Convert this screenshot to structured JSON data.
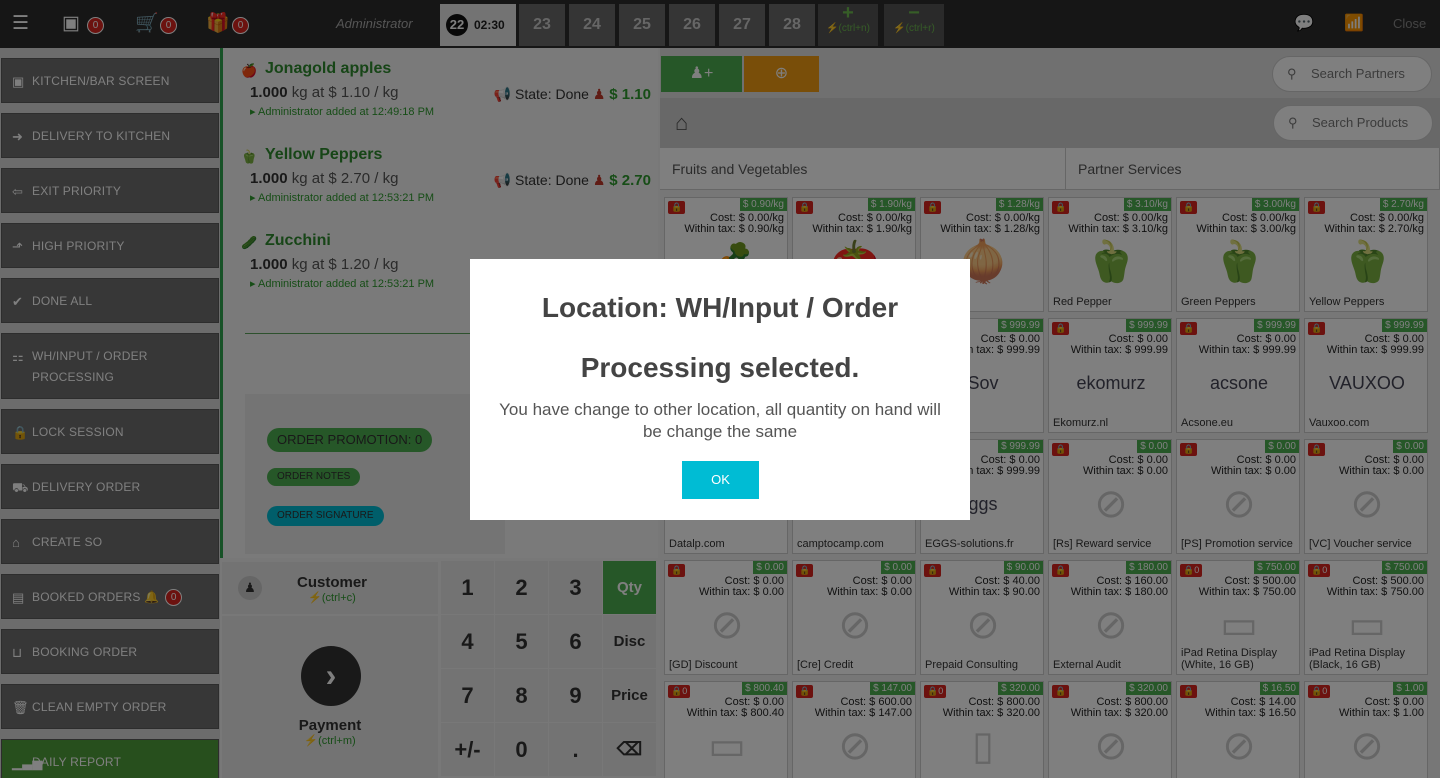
{
  "topbar": {
    "badges": [
      "0",
      "0",
      "0"
    ],
    "user": "Administrator",
    "active_tab": {
      "number": "22",
      "time": "02:30"
    },
    "tabs": [
      "23",
      "24",
      "25",
      "26",
      "27",
      "28"
    ],
    "add_order": {
      "symbol": "+",
      "shortcut": "(ctrl+n)"
    },
    "remove_order": {
      "symbol": "−",
      "shortcut": "(ctrl+r)"
    },
    "close": "Close"
  },
  "left_menu": {
    "items": [
      {
        "label": "KITCHEN/BAR SCREEN",
        "icon": "monitor-icon",
        "glyph": "▣"
      },
      {
        "label": "DELIVERY TO KITCHEN",
        "icon": "arrow-circle-right-icon",
        "glyph": "➜"
      },
      {
        "label": "EXIT PRIORITY",
        "icon": "arrow-circle-left-icon",
        "glyph": "⇦"
      },
      {
        "label": "HIGH PRIORITY",
        "icon": "level-up-icon",
        "glyph": "⬏"
      },
      {
        "label": "DONE ALL",
        "icon": "check-circle-icon",
        "glyph": "✔"
      },
      {
        "label": "WH/INPUT / ORDER",
        "label2": "PROCESSING",
        "icon": "sitemap-icon",
        "glyph": "⚏"
      },
      {
        "label": "LOCK SESSION",
        "icon": "lock-icon",
        "glyph": "🔒"
      },
      {
        "label": "DELIVERY ORDER",
        "icon": "truck-icon",
        "glyph": "⛟"
      },
      {
        "label": "CREATE SO",
        "icon": "shopping-bag-icon",
        "glyph": "⌂"
      },
      {
        "label": "BOOKED ORDERS",
        "icon": "book-icon",
        "glyph": "▤",
        "badge": "0"
      },
      {
        "label": "BOOKING ORDER",
        "icon": "basket-icon",
        "glyph": "⊔"
      },
      {
        "label": "CLEAN EMPTY ORDER",
        "icon": "trash-icon",
        "glyph": "🗑"
      },
      {
        "label": "DAILY REPORT",
        "icon": "signal-icon",
        "glyph": "▁▃▅"
      }
    ]
  },
  "order": {
    "lines": [
      {
        "name": "Jonagold apples",
        "qty": "1.000",
        "detail": "kg at $ 1.10 / kg",
        "state": "State: Done",
        "price": "$ 1.10",
        "added": "Administrator added at 12:49:18 PM",
        "emoji": "🍎"
      },
      {
        "name": "Yellow Peppers",
        "qty": "1.000",
        "detail": "kg at $ 2.70 / kg",
        "state": "State: Done",
        "price": "$ 2.70",
        "added": "Administrator added at 12:53:21 PM",
        "emoji": "🫑"
      },
      {
        "name": "Zucchini",
        "qty": "1.000",
        "detail": "kg at $ 1.20 / kg",
        "added": "Administrator added at 12:53:21 PM",
        "emoji": "🥒"
      }
    ],
    "promotion": "ORDER PROMOTION: 0",
    "notes": "ORDER NOTES",
    "signature": "ORDER SIGNATURE"
  },
  "numpad": {
    "customer_label": "Customer",
    "customer_shortcut": "(ctrl+c)",
    "payment_label": "Payment",
    "payment_shortcut": "(ctrl+m)",
    "keys": [
      "1",
      "2",
      "3",
      "4",
      "5",
      "6",
      "7",
      "8",
      "9",
      "+/-",
      "0",
      "."
    ],
    "modes": [
      "Qty",
      "Disc",
      "Price"
    ],
    "backspace": "⌫"
  },
  "right": {
    "search_partners": "Search Partners",
    "search_products": "Search Products",
    "categories": [
      "Fruits and Vegetables",
      "Partner Services"
    ],
    "products": [
      {
        "name": "",
        "price": "$ 0.90/kg",
        "cost": "Cost: $ 0.00/kg",
        "tax": "Within tax: $ 0.90/kg",
        "img": "🥕"
      },
      {
        "name": "",
        "price": "$ 1.90/kg",
        "cost": "Cost: $ 0.00/kg",
        "tax": "Within tax: $ 1.90/kg",
        "img": "🍅"
      },
      {
        "name": "",
        "price": "$ 1.28/kg",
        "cost": "Cost: $ 0.00/kg",
        "tax": "Within tax: $ 1.28/kg",
        "img": "🧅"
      },
      {
        "name": "Red Pepper",
        "price": "$ 3.10/kg",
        "cost": "Cost: $ 0.00/kg",
        "tax": "Within tax: $ 3.10/kg",
        "img": "🫑"
      },
      {
        "name": "Green Peppers",
        "price": "$ 3.00/kg",
        "cost": "Cost: $ 0.00/kg",
        "tax": "Within tax: $ 3.00/kg",
        "img": "🫑"
      },
      {
        "name": "Yellow Peppers",
        "price": "$ 2.70/kg",
        "cost": "Cost: $ 0.00/kg",
        "tax": "Within tax: $ 2.70/kg",
        "img": "🫑"
      },
      {
        "name": "",
        "price": "",
        "cost": "",
        "tax": "",
        "img": ""
      },
      {
        "name": "",
        "price": "",
        "cost": "",
        "tax": "",
        "img": ""
      },
      {
        "name": "",
        "price": "$ 999.99",
        "cost": "Cost: $ 0.00",
        "tax": "Within tax: $ 999.99",
        "img": "Sov"
      },
      {
        "name": "Ekomurz.nl",
        "price": "$ 999.99",
        "cost": "Cost: $ 0.00",
        "tax": "Within tax: $ 999.99",
        "img": "ekomurz"
      },
      {
        "name": "Acsone.eu",
        "price": "$ 999.99",
        "cost": "Cost: $ 0.00",
        "tax": "Within tax: $ 999.99",
        "img": "acsone"
      },
      {
        "name": "Vauxoo.com",
        "price": "$ 999.99",
        "cost": "Cost: $ 0.00",
        "tax": "Within tax: $ 999.99",
        "img": "VAUXOO"
      },
      {
        "name": "Datalp.com",
        "price": "",
        "cost": "",
        "tax": "",
        "img": ""
      },
      {
        "name": "camptocamp.com",
        "price": "",
        "cost": "",
        "tax": "",
        "img": ""
      },
      {
        "name": "EGGS-solutions.fr",
        "price": "$ 999.99",
        "cost": "Cost: $ 0.00",
        "tax": "Within tax: $ 999.99",
        "img": "ggs"
      },
      {
        "name": "[Rs] Reward service",
        "price": "$ 0.00",
        "cost": "Cost: $ 0.00",
        "tax": "Within tax: $ 0.00",
        "img": "⊘"
      },
      {
        "name": "[PS] Promotion service",
        "price": "$ 0.00",
        "cost": "Cost: $ 0.00",
        "tax": "Within tax: $ 0.00",
        "img": "⊘"
      },
      {
        "name": "[VC] Voucher service",
        "price": "$ 0.00",
        "cost": "Cost: $ 0.00",
        "tax": "Within tax: $ 0.00",
        "img": "⊘"
      },
      {
        "name": "[GD] Discount",
        "price": "$ 0.00",
        "cost": "Cost: $ 0.00",
        "tax": "Within tax: $ 0.00",
        "img": "⊘"
      },
      {
        "name": "[Cre] Credit",
        "price": "$ 0.00",
        "cost": "Cost: $ 0.00",
        "tax": "Within tax: $ 0.00",
        "img": "⊘"
      },
      {
        "name": "Prepaid Consulting",
        "price": "$ 90.00",
        "cost": "Cost: $ 40.00",
        "tax": "Within tax: $ 90.00",
        "img": "⊘"
      },
      {
        "name": "External Audit",
        "price": "$ 180.00",
        "cost": "Cost: $ 160.00",
        "tax": "Within tax: $ 180.00",
        "img": "⊘"
      },
      {
        "name": "iPad Retina Display (White, 16 GB)",
        "price": "$ 750.00",
        "cost": "Cost: $ 500.00",
        "tax": "Within tax: $ 750.00",
        "img": "▭",
        "lock": "0"
      },
      {
        "name": "iPad Retina Display (Black, 16 GB)",
        "price": "$ 750.00",
        "cost": "Cost: $ 500.00",
        "tax": "Within tax: $ 750.00",
        "img": "▭",
        "lock": "0"
      },
      {
        "name": "iPad Retina Display",
        "price": "$ 800.40",
        "cost": "Cost: $ 0.00",
        "tax": "Within tax: $ 800.40",
        "img": "▭",
        "lock": "0"
      },
      {
        "name": "",
        "price": "$ 147.00",
        "cost": "Cost: $ 600.00",
        "tax": "Within tax: $ 147.00",
        "img": "⊘"
      },
      {
        "name": "",
        "price": "$ 320.00",
        "cost": "Cost: $ 800.00",
        "tax": "Within tax: $ 320.00",
        "img": "▯",
        "lock": "0"
      },
      {
        "name": "",
        "price": "$ 320.00",
        "cost": "Cost: $ 800.00",
        "tax": "Within tax: $ 320.00",
        "img": "⊘"
      },
      {
        "name": "",
        "price": "$ 16.50",
        "cost": "Cost: $ 14.00",
        "tax": "Within tax: $ 16.50",
        "img": "⊘"
      },
      {
        "name": "",
        "price": "$ 1.00",
        "cost": "Cost: $ 0.00",
        "tax": "Within tax: $ 1.00",
        "img": "⊘",
        "lock": "0"
      }
    ]
  },
  "modal": {
    "title_line1": "Location: WH/Input / Order",
    "title_line2": "Processing selected.",
    "body": "You have change to other location, all quantity on hand will be change the same",
    "ok": "OK"
  },
  "colors": {
    "green": "#4caf50",
    "orange": "#f39c12",
    "cyan": "#00bcd4",
    "red": "#d9251f",
    "dark": "#2d2d2d"
  }
}
